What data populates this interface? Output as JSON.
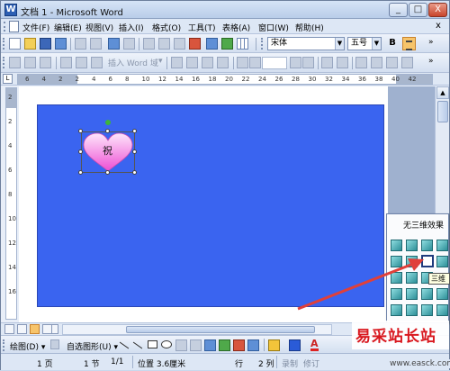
{
  "window": {
    "title": "文档 1 - Microsoft Word",
    "minimize": "_",
    "maximize": "□",
    "close": "X"
  },
  "menu": {
    "items": [
      "文件(F)",
      "编辑(E)",
      "视图(V)",
      "插入(I)",
      "格式(O)",
      "工具(T)",
      "表格(A)",
      "窗口(W)",
      "帮助(H)"
    ],
    "close_glyph": "x"
  },
  "toolbar_standard": {
    "font_name": "宋体",
    "font_size": "五号",
    "bold_label": "B"
  },
  "toolbar_mailmerge": {
    "insert_word_field": "插入 Word 域",
    "insert_word_field_arrow": "▾"
  },
  "ruler": {
    "corner_label": "L",
    "numbers": [
      "6",
      "4",
      "2",
      "2",
      "4",
      "6",
      "8",
      "10",
      "12",
      "14",
      "16",
      "18",
      "20",
      "22",
      "24",
      "26",
      "28",
      "30",
      "32",
      "34",
      "36",
      "38",
      "40",
      "42"
    ],
    "vnumbers": [
      "2",
      "2",
      "4",
      "6",
      "8",
      "10",
      "12",
      "14",
      "16"
    ]
  },
  "document": {
    "background_color": "#3a64f0",
    "heart_text": "祝"
  },
  "popup_3d": {
    "title": "无三维效果",
    "tooltip": "三维"
  },
  "draw_toolbar": {
    "draw_menu": "绘图(D) ▾",
    "autoshapes_menu": "自选图形(U) ▾",
    "font_color_letter": "A"
  },
  "status": {
    "page": "1 页",
    "section": "1 节",
    "page_of": "1/1",
    "position": "位置 3.6厘米",
    "line": "行",
    "column": "2 列",
    "rec": "录制",
    "trk": "修订"
  },
  "watermark": {
    "brand": "易采站长站",
    "url": "www.easck.com"
  },
  "colors": {
    "accent": "#3a64f0",
    "arrow": "#e0403a",
    "heart_top": "#fde6fb",
    "heart_bottom": "#ee4ed4"
  }
}
